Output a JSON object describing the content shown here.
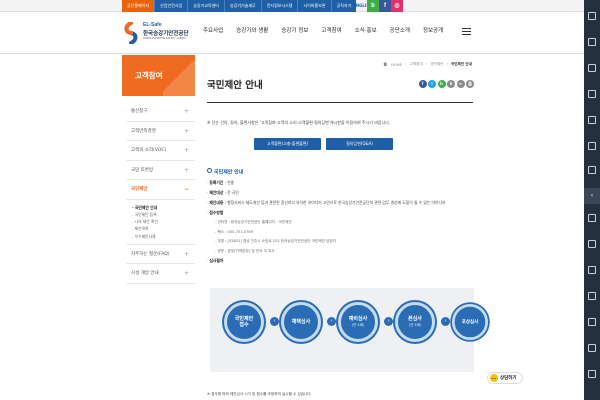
{
  "topbar": {
    "links": [
      "공단홈페이지",
      "산업안전사업",
      "승강기교육센터",
      "승강기기술세무",
      "전자정보시스템",
      "사이버홍보관",
      "공직자가"
    ],
    "lang": "ENGLISH",
    "sns": [
      {
        "name": "blog",
        "letter": "b",
        "color": "#3fae49"
      },
      {
        "name": "facebook",
        "letter": "f",
        "color": "#3b5998"
      },
      {
        "name": "instagram",
        "letter": "◎",
        "color": "#e1306c"
      }
    ]
  },
  "logo": {
    "en": "EL-Safe",
    "ko": "한국승강기안전공단",
    "sub": "KOREA ELEVATOR SAFETY AGENCY"
  },
  "gnb": [
    "주요사업",
    "승강기와 생활",
    "승강기 정보",
    "고객참여",
    "소식·홍보",
    "공단소개",
    "정보공개"
  ],
  "sidebar": {
    "title": "고객참여",
    "items": [
      {
        "label": "통신창구",
        "plus": "+",
        "active": false
      },
      {
        "label": "고객만족경영",
        "plus": "+",
        "active": false
      },
      {
        "label": "고객의 소리(VOC)",
        "plus": "+",
        "active": false
      },
      {
        "label": "국민 토론방",
        "plus": "+",
        "active": false
      },
      {
        "label": "국민제안",
        "plus": "−",
        "active": true
      }
    ],
    "sub": [
      "국민제안 안내",
      "국민제안 등록",
      "나의 제안 확인",
      "제안목록",
      "우수제안사례"
    ],
    "after": [
      {
        "label": "자주하는 질문(FAQ)",
        "plus": "+"
      },
      {
        "label": "시설 개방 안내",
        "plus": "+"
      }
    ]
  },
  "breadcrumb": {
    "home": "HOME",
    "items": [
      "고객참여",
      "국민제안",
      "국민제안 안내"
    ]
  },
  "page": {
    "title": "국민제안 안내",
    "share": [
      {
        "name": "facebook",
        "letter": "f",
        "color": "#3b5998"
      },
      {
        "name": "twitter",
        "letter": "t",
        "color": "#1da1f2"
      },
      {
        "name": "blog",
        "letter": "b",
        "color": "#3fae49"
      },
      {
        "name": "kakao",
        "letter": "k",
        "color": "#8a8a8a"
      },
      {
        "name": "link",
        "letter": "∞",
        "color": "#8a8a8a"
      },
      {
        "name": "print",
        "letter": "⎙",
        "color": "#8a8a8a"
      }
    ],
    "intro": "※ 단순 건의, 질의, 불편사항은 '고객참여-고객의 소리-고객불편·질의답변'게시판을 이용하여 주시기 바랍니다.",
    "buttons": [
      "고객불편(고충·불편불편)",
      "질의답변(Q&A)"
    ]
  },
  "info": {
    "heading": "국민제안 안내",
    "rows": [
      {
        "label": "등록기간",
        "value": "연중"
      },
      {
        "label": "제안대상",
        "value": "전 국민"
      },
      {
        "label": "제안내용",
        "value": "행정서비스 제도개선 등과 관련된 참신하고 유익한 아이디어 고안으로 한국승강기안전공단의 관련 업무 개선에 도움이 될 수 있는 아이디어"
      },
      {
        "label": "접수방법",
        "value": ""
      }
    ],
    "methods": [
      "- 인터넷 : 한국승강기안전공단 홈페이지 - 국민제안",
      "- 팩스 : 055-751-0769",
      "- 우편 : [52851] 경남 진주시 소호로 102 한국승강기안전공단 국민제안 담당자",
      "- 방문 : 본부(지역본부) 및 전국 각 지사"
    ],
    "process_label": "심사절차"
  },
  "process": [
    {
      "title": "국민제안\n접수",
      "detail": ""
    },
    {
      "title": "채택심사",
      "detail": ""
    },
    {
      "title": "예비심사",
      "detail": "(연 4회)"
    },
    {
      "title": "본심사",
      "detail": "(연 4회)"
    },
    {
      "title": "포상심사",
      "detail": ""
    }
  ],
  "footnote": "※ 경우에 따라 제안심사 시기 및 횟수를 조정하여 실시할 수 있습니다.",
  "faq_button": "상담하기",
  "quickbar": {
    "top_label": "TOP"
  }
}
